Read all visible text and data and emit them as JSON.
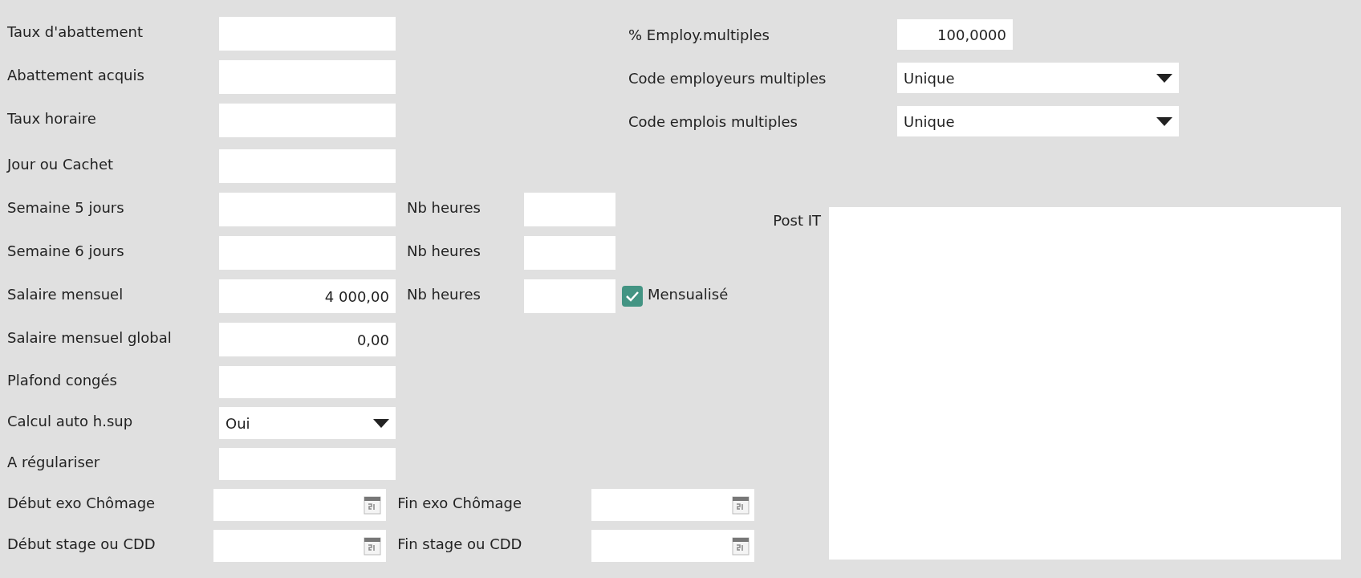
{
  "rows": [
    {
      "label": "Taux d'abattement",
      "field": {
        "kind": "text"
      }
    },
    {
      "label": "Abattement acquis",
      "field": {
        "kind": "text"
      }
    },
    {
      "label": "Taux horaire",
      "field": {
        "kind": "text"
      }
    },
    {
      "label": "Jour ou Cachet",
      "field": {
        "kind": "text"
      }
    },
    {
      "label": "Semaine 5 jours",
      "field": {
        "kind": "text"
      },
      "secondary": {
        "label": "Nb heures",
        "field": {
          "kind": "small"
        }
      }
    },
    {
      "label": "Semaine 6 jours",
      "field": {
        "kind": "text"
      },
      "secondary": {
        "label": "Nb heures",
        "field": {
          "kind": "small"
        }
      }
    },
    {
      "label": "Salaire mensuel",
      "field": {
        "kind": "text",
        "value": "4 000,00"
      },
      "secondary": {
        "label": "Nb heures",
        "field": {
          "kind": "small"
        },
        "checkbox": {
          "label": "Mensualisé",
          "checked": true
        }
      }
    },
    {
      "label": "Salaire mensuel global",
      "field": {
        "kind": "text",
        "value": "0,00"
      }
    },
    {
      "label": "Plafond congés",
      "field": {
        "kind": "text"
      }
    },
    {
      "label": "Calcul auto h.sup",
      "field": {
        "kind": "select",
        "value": "Oui"
      }
    },
    {
      "label": "A régulariser",
      "field": {
        "kind": "text"
      }
    },
    {
      "label": "Début exo Chômage",
      "field": {
        "kind": "date"
      },
      "secondary": {
        "label": "Fin exo Chômage",
        "field": {
          "kind": "date"
        }
      }
    },
    {
      "label": "Début stage ou CDD",
      "field": {
        "kind": "date"
      },
      "secondary": {
        "label": "Fin stage ou CDD",
        "field": {
          "kind": "date"
        }
      }
    }
  ],
  "multi_employment": [
    {
      "label": "% Employ.multiples",
      "field": {
        "kind": "text",
        "value": "100,0000"
      }
    },
    {
      "label": "Code employeurs multiples",
      "field": {
        "kind": "select",
        "value": "Unique"
      }
    },
    {
      "label": "Code emplois multiples",
      "field": {
        "kind": "select",
        "value": "Unique"
      }
    }
  ],
  "post_it": {
    "label": "Post IT"
  }
}
